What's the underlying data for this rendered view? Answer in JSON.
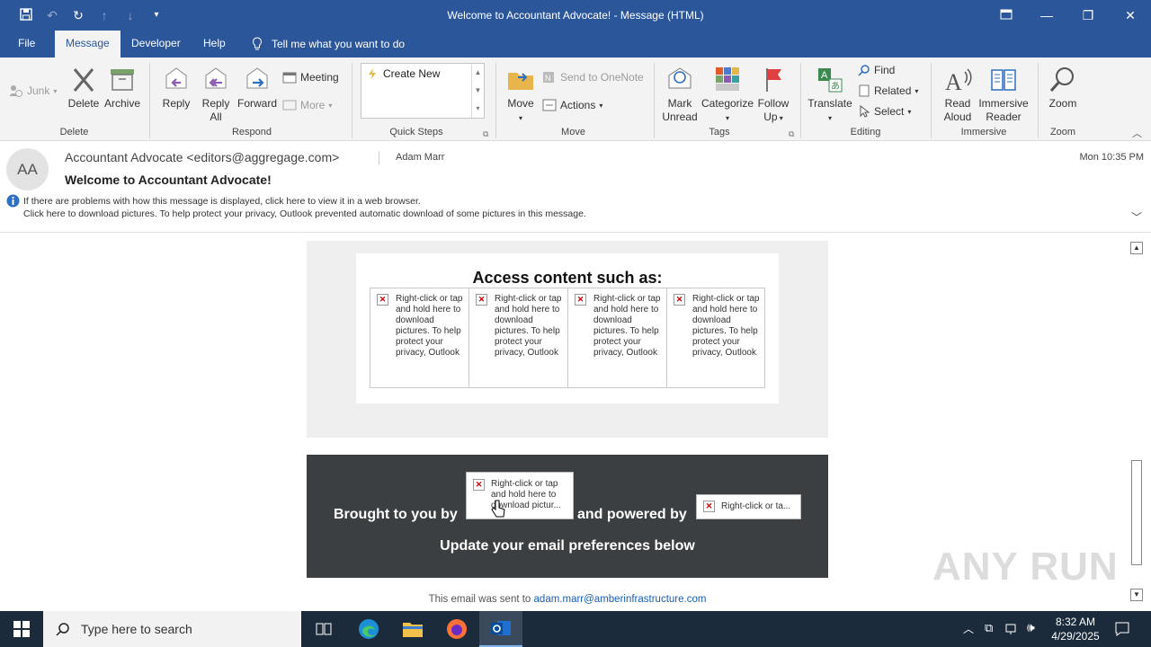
{
  "window": {
    "title": "Welcome to Accountant Advocate!  -  Message (HTML)"
  },
  "tabs": [
    {
      "label": "File"
    },
    {
      "label": "Message"
    },
    {
      "label": "Developer"
    },
    {
      "label": "Help"
    }
  ],
  "tell_me": "Tell me what you want to do",
  "ribbon": {
    "junk": "Junk",
    "delete": "Delete",
    "archive": "Archive",
    "delete_group": "Delete",
    "reply": "Reply",
    "reply_all_1": "Reply",
    "reply_all_2": "All",
    "forward": "Forward",
    "meeting": "Meeting",
    "more": "More",
    "respond_group": "Respond",
    "create_new": "Create New",
    "quick_steps_group": "Quick Steps",
    "move": "Move",
    "send_onenote": "Send to OneNote",
    "actions": "Actions",
    "move_group": "Move",
    "mark_unread_1": "Mark",
    "mark_unread_2": "Unread",
    "categorize": "Categorize",
    "follow_up_1": "Follow",
    "follow_up_2": "Up",
    "tags_group": "Tags",
    "translate": "Translate",
    "find": "Find",
    "related": "Related",
    "select": "Select",
    "editing_group": "Editing",
    "read_aloud_1": "Read",
    "read_aloud_2": "Aloud",
    "immersive_1": "Immersive",
    "immersive_2": "Reader",
    "immersive_group": "Immersive",
    "zoom": "Zoom",
    "zoom_group": "Zoom"
  },
  "message": {
    "avatar": "AA",
    "from": "Accountant Advocate <editors@aggregage.com>",
    "to": "Adam Marr",
    "date": "Mon 10:35 PM",
    "subject": "Welcome to Accountant Advocate!",
    "info1": "If there are problems with how this message is displayed, click here to view it in a web browser.",
    "info2": "Click here to download pictures. To help protect your privacy, Outlook prevented automatic download of some pictures in this message."
  },
  "body": {
    "access_heading": "Access content such as:",
    "placeholder_text": "Right-click or tap and hold here to download pictures. To help protect your privacy, Outlook",
    "brought_by": "Brought to you by",
    "brought_img": "Right-click or tap and hold here to download pictur...",
    "powered_by": "and powered by",
    "powered_img": "Right-click or ta...",
    "update_prefs": "Update your email preferences below",
    "sent_to_prefix": "This email was sent to",
    "sent_to_email": "adam.marr@amberinfrastructure.com"
  },
  "watermark": "ANY RUN",
  "taskbar": {
    "search_placeholder": "Type here to search",
    "time": "8:32 AM",
    "date": "4/29/2025"
  },
  "colors": {
    "outlook_blue": "#2b579a",
    "dark_panel": "#3c3f41",
    "taskbar": "#1c2b3b"
  }
}
